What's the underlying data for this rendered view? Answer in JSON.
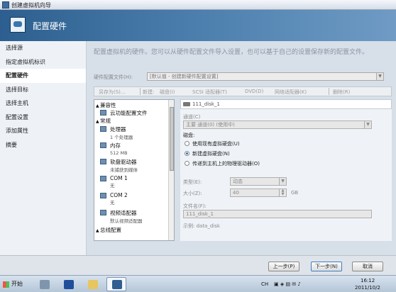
{
  "window": {
    "title": "创建虚拟机向导"
  },
  "header": {
    "title": "配置硬件"
  },
  "nav": {
    "items": [
      "选择源",
      "指定虚拟机标识",
      "配置硬件",
      "选择目标",
      "选择主机",
      "配置设置",
      "添加属性",
      "摘要"
    ],
    "active_index": 2
  },
  "main": {
    "intro": "配置虚拟机的硬件。您可以从硬件配置文件导入设置，也可以基于自己的设置保存新的配置文件。",
    "profile_label": "硬件配置文件(H):",
    "profile_value": "[默认值 - 创建新硬件配置设置]",
    "toolbar": {
      "save_as": "另存为(S)...",
      "new": "新建:",
      "disk": "磁盘(I)",
      "scsi": "SCSI 适配器(T)",
      "dvd": "DVD(D)",
      "nic": "网络适配器(K)",
      "remove": "删除(R)"
    }
  },
  "tree": {
    "groups": [
      "兼容性",
      "常规",
      "总线配置"
    ],
    "items": [
      {
        "label": "云功能配置文件",
        "sub": ""
      },
      {
        "label": "处理器",
        "sub": "1 个处理器"
      },
      {
        "label": "内存",
        "sub": "512 MB"
      },
      {
        "label": "软盘驱动器",
        "sub": "未捕获到媒体"
      },
      {
        "label": "COM 1",
        "sub": "无"
      },
      {
        "label": "COM 2",
        "sub": "无"
      },
      {
        "label": "视频适配器",
        "sub": "默认视频适配器"
      }
    ]
  },
  "detail": {
    "disk_name": "111_disk_1",
    "channel_label": "通道(C)",
    "channel_value": "主要 通道(0) (使用中)",
    "disk_label": "磁盘:",
    "radios": [
      "使用现有虚拟硬盘(U)",
      "新建虚拟硬盘(N)",
      "传递到主机上的物理驱动器(O)"
    ],
    "selected_radio": 1,
    "type_label": "类型(E):",
    "type_value": "动态",
    "size_label": "大小(Z):",
    "size_value": "40",
    "size_unit": "GB",
    "filename_label": "文件名(F):",
    "filename_value": "111_disk_1",
    "example": "示例: data_disk"
  },
  "footer": {
    "prev": "上一步(P)",
    "next": "下一步(N)",
    "cancel": "取消"
  },
  "taskbar": {
    "start": "开始",
    "lang": "CH",
    "time": "16:12",
    "date": "2011/10/2"
  }
}
